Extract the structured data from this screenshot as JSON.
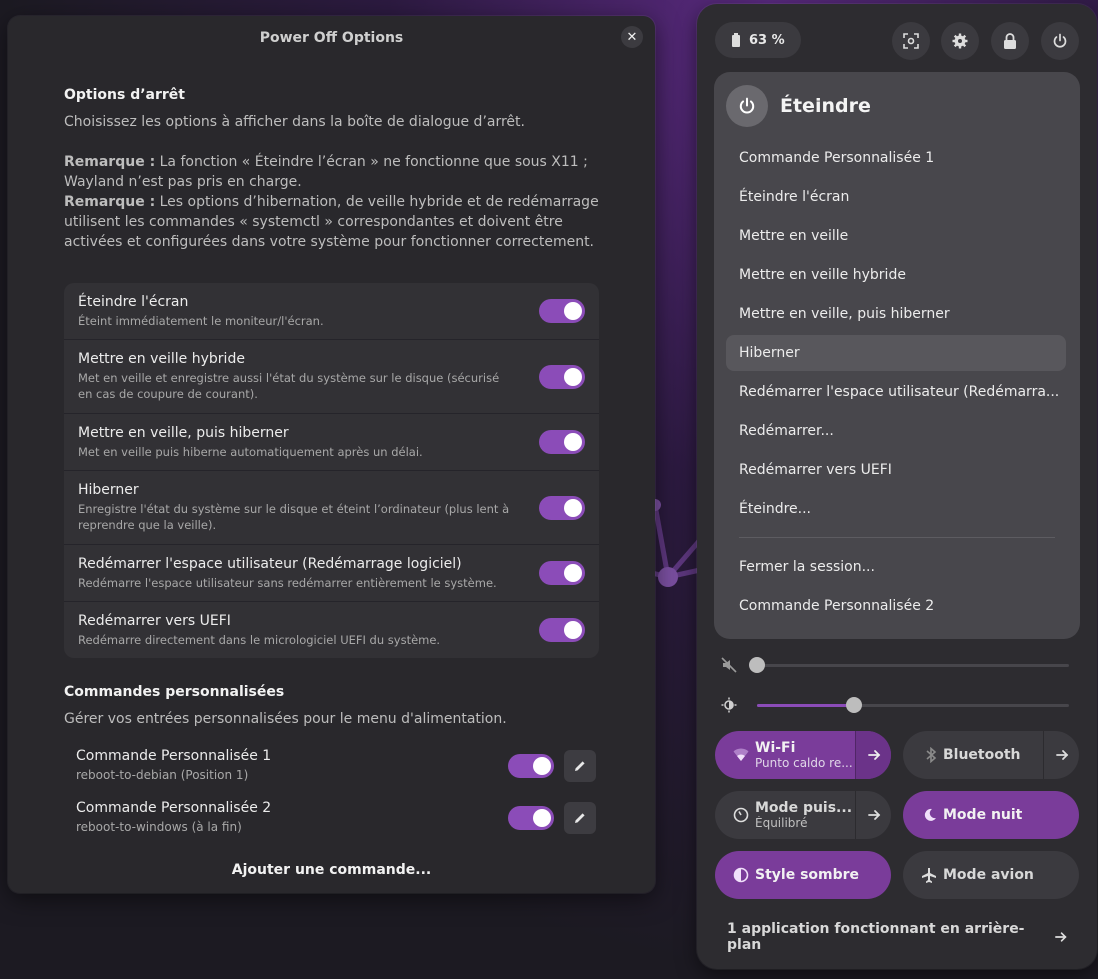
{
  "dialog": {
    "title": "Power Off Options",
    "options_title": "Options d’arrêt",
    "options_desc": "Choisissez les options à afficher dans la boîte de dialogue d’arrêt.",
    "note_label": "Remarque :",
    "note1": "La fonction « Éteindre l’écran » ne fonctionne que sous X11 ; Wayland n’est pas pris en charge.",
    "note2": "Les options d’hibernation, de veille hybride et de redémarrage utilisent les commandes « systemctl » correspondantes et doivent être activées et configurées dans votre système pour fonctionner correctement.",
    "options": [
      {
        "title": "Éteindre l'écran",
        "desc": "Éteint immédiatement le moniteur/l'écran."
      },
      {
        "title": "Mettre en veille hybride",
        "desc": "Met en veille et enregistre aussi l'état du système sur le disque (sécurisé en cas de coupure de courant)."
      },
      {
        "title": "Mettre en veille, puis hiberner",
        "desc": "Met en veille puis hiberne automatiquement après un délai."
      },
      {
        "title": "Hiberner",
        "desc": "Enregistre l'état du système sur le disque et éteint l’ordinateur (plus lent à reprendre que la veille)."
      },
      {
        "title": "Redémarrer l'espace utilisateur (Redémarrage logiciel)",
        "desc": "Redémarre l'espace utilisateur sans redémarrer entièrement le système."
      },
      {
        "title": "Redémarrer vers UEFI",
        "desc": "Redémarre directement dans le micrologiciel UEFI du système."
      }
    ],
    "custom_title": "Commandes personnalisées",
    "custom_desc": "Gérer vos entrées personnalisées pour le menu d'alimentation.",
    "commands": [
      {
        "title": "Commande Personnalisée 1",
        "sub": "reboot-to-debian (Position 1)"
      },
      {
        "title": "Commande Personnalisée 2",
        "sub": "reboot-to-windows (à la fin)"
      }
    ],
    "add_command": "Ajouter une commande..."
  },
  "panel": {
    "battery": "63 %",
    "power_menu": {
      "title": "Éteindre",
      "items": [
        "Commande Personnalisée 1",
        "Éteindre l'écran",
        "Mettre en veille",
        "Mettre en veille hybride",
        "Mettre en veille, puis hiberner",
        "Hiberner",
        "Redémarrer l'espace utilisateur (Redémarra...",
        "Redémarrer...",
        "Redémarrer vers UEFI",
        "Éteindre...",
        "Fermer la session...",
        "Commande Personnalisée 2"
      ]
    },
    "volume_level": 0.0,
    "brightness_level": 0.31,
    "tiles": {
      "wifi": {
        "label": "Wi-Fi",
        "sub": "Punto caldo re..."
      },
      "bluetooth": {
        "label": "Bluetooth"
      },
      "power_mode": {
        "label": "Mode puis...",
        "sub": "Équilibré"
      },
      "night": {
        "label": "Mode nuit"
      },
      "dark": {
        "label": "Style sombre"
      },
      "airplane": {
        "label": "Mode avion"
      }
    },
    "background_apps": "1 application fonctionnant en arrière-plan"
  },
  "colors": {
    "accent": "#8b4cb8",
    "tile_active": "#7a3c9a"
  }
}
